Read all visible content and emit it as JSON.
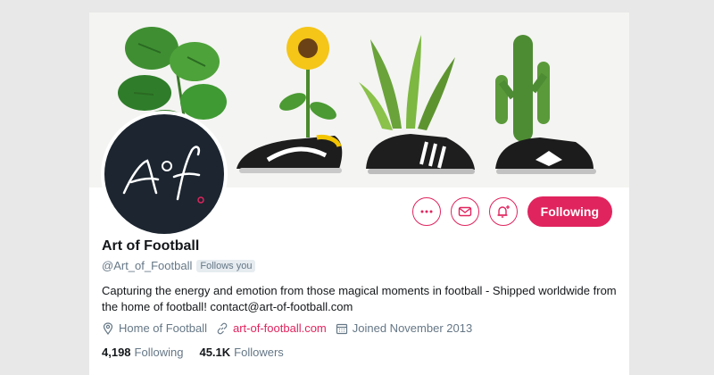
{
  "profile": {
    "name": "Art of Football",
    "handle": "@Art_of_Football",
    "follows_you": "Follows you",
    "bio": "Capturing the energy and emotion from those magical moments in football - Shipped worldwide from the home of football! contact@art-of-football.com",
    "location": "Home of Football",
    "website": "art-of-football.com",
    "joined": "Joined November 2013",
    "following_count": "4,198",
    "following_label": "Following",
    "followers_count": "45.1K",
    "followers_label": "Followers"
  },
  "actions": {
    "more_icon": "more-horizontal-icon",
    "message_icon": "envelope-icon",
    "notify_icon": "bell-plus-icon",
    "follow_label": "Following"
  },
  "colors": {
    "accent": "#e0245e",
    "text_primary": "#14171a",
    "text_secondary": "#657786",
    "avatar_bg": "#1c2530"
  }
}
